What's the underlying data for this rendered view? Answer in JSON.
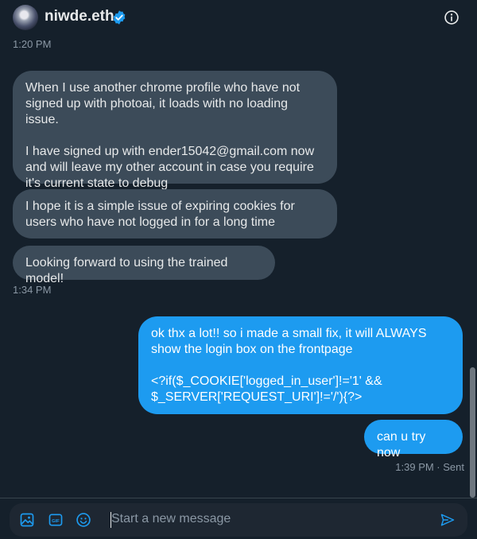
{
  "header": {
    "username": "niwde.eth"
  },
  "messages": [
    {
      "type": "timestamp",
      "text": "1:20 PM"
    },
    {
      "type": "received",
      "text": "When I use another chrome profile who have not signed up with photoai, it loads with no loading issue.\n\nI have signed up with ender15042@gmail.com now and will leave my other account in case you require it's current state to debug"
    },
    {
      "type": "received",
      "text": "I hope it is a simple issue of expiring cookies for users who have not logged in for a long time"
    },
    {
      "type": "received",
      "text": "Looking forward to using the trained model!"
    },
    {
      "type": "timestamp",
      "text": "1:34 PM"
    },
    {
      "type": "sent",
      "text": "ok thx a lot!! so i made a small fix, it will ALWAYS show the login box on the frontpage\n\n<?if($_COOKIE['logged_in_user']!='1' && $_SERVER['REQUEST_URI']!='/'){?>"
    },
    {
      "type": "sent",
      "text": "can u try now"
    },
    {
      "type": "timestamp",
      "text": "1:39 PM · Sent"
    }
  ],
  "composer": {
    "placeholder": "Start a new message",
    "icons": [
      "media-icon",
      "gif-icon",
      "emoji-icon",
      "send-icon"
    ]
  },
  "colors": {
    "background": "#15202b",
    "received_bubble": "#3c4b59",
    "sent_bubble": "#1d9bf0",
    "verified": "#1d9bf0",
    "muted_text": "#8b98a5"
  }
}
